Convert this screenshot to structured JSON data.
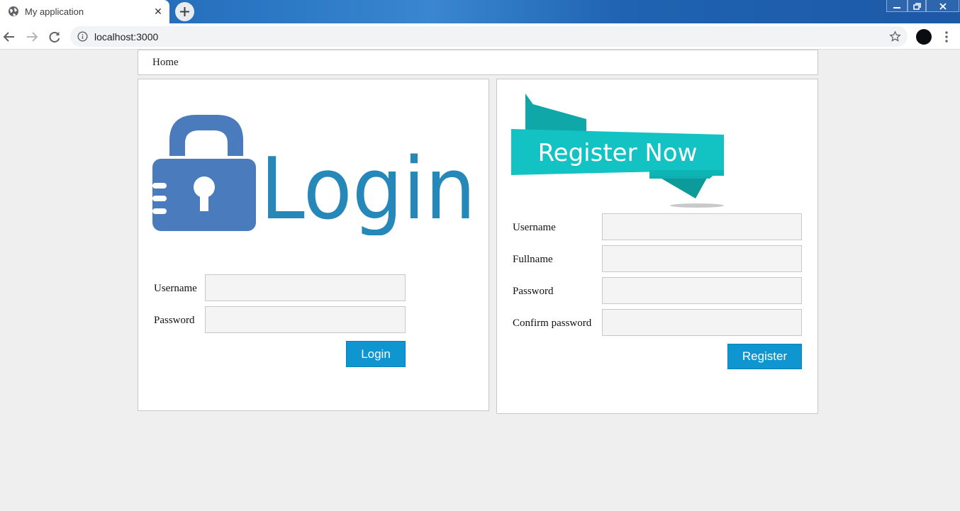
{
  "browser": {
    "tab_title": "My application",
    "url": "localhost:3000"
  },
  "nav": {
    "home_label": "Home"
  },
  "login": {
    "logo_text": "Login",
    "username_label": "Username",
    "password_label": "Password",
    "username_value": "",
    "password_value": "",
    "button_label": "Login"
  },
  "register": {
    "banner_text": "Register Now",
    "username_label": "Username",
    "fullname_label": "Fullname",
    "password_label": "Password",
    "confirm_label": "Confirm password",
    "button_label": "Register"
  },
  "colors": {
    "lock_blue": "#4a7bbd",
    "login_text": "#2588b8",
    "banner_teal": "#13c3c3",
    "button_blue": "#0f96d1"
  },
  "icons": {
    "favicon": "globe-icon",
    "close": "close-icon",
    "new_tab": "plus-icon",
    "back": "back-arrow-icon",
    "forward": "forward-arrow-icon",
    "reload": "reload-icon",
    "info": "info-icon",
    "bookmark": "star-icon",
    "menu": "more-vert-icon",
    "lock": "padlock-icon"
  }
}
